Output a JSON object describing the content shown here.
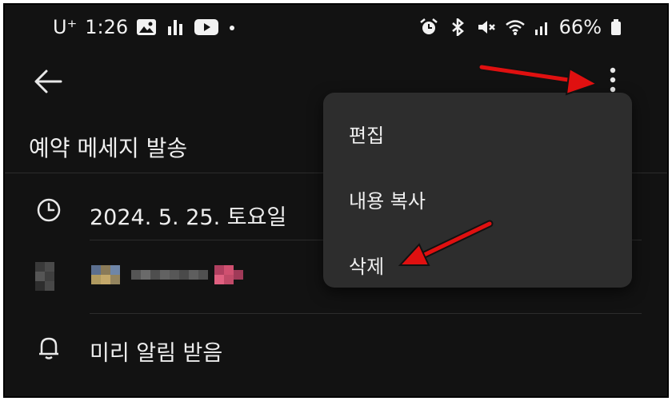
{
  "status_bar": {
    "carrier": "U⁺",
    "time": "1:26",
    "battery": "66%",
    "icons_left": [
      "image-icon",
      "chart-icon",
      "youtube-icon",
      "dot-icon"
    ],
    "icons_right": [
      "alarm-icon",
      "bluetooth-icon",
      "mute-icon",
      "wifi-icon",
      "signal-icon",
      "battery-icon"
    ]
  },
  "app_bar": {
    "back_icon": "arrow-left-icon",
    "more_icon": "more-vertical-icon"
  },
  "page": {
    "title": "예약 메세지 발송"
  },
  "details": {
    "schedule_date": "2024. 5. 25. 토요일",
    "reminder_label": "미리 알림 받음"
  },
  "menu": {
    "items": [
      {
        "label": "편집"
      },
      {
        "label": "내용 복사"
      },
      {
        "label": "삭제"
      }
    ]
  },
  "annotation_color": "#e01010",
  "colors": {
    "background": "#121212",
    "menu": "#2d2d2d",
    "text": "#eeeeee"
  }
}
